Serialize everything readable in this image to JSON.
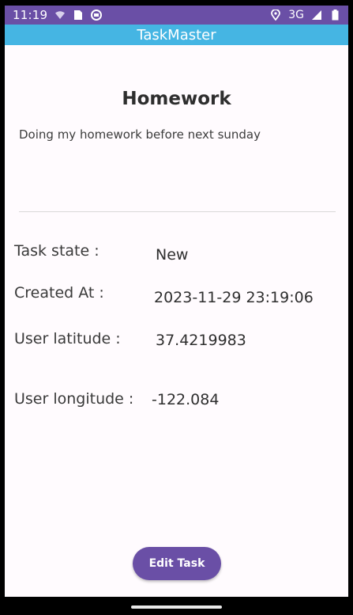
{
  "status_bar": {
    "time": "11:19",
    "network": "3G",
    "icons": [
      "wifi-icon",
      "sim-card-icon",
      "notification-icon",
      "location-icon",
      "signal-icon",
      "battery-icon"
    ]
  },
  "app_bar": {
    "title": "TaskMaster"
  },
  "task": {
    "title": "Homework",
    "description": "Doing my homework before next sunday"
  },
  "details": {
    "state_label": "Task state :",
    "state_value": "New",
    "created_label": "Created At :",
    "created_value": "2023-11-29 23:19:06",
    "latitude_label": "User latitude :",
    "latitude_value": "37.4219983",
    "longitude_label": "User longitude :",
    "longitude_value": "-122.084"
  },
  "actions": {
    "edit_label": "Edit Task"
  },
  "colors": {
    "status_bar": "#6a4fa6",
    "app_bar": "#45b5e3",
    "button": "#6a4fa6",
    "background": "#fffbfe"
  }
}
